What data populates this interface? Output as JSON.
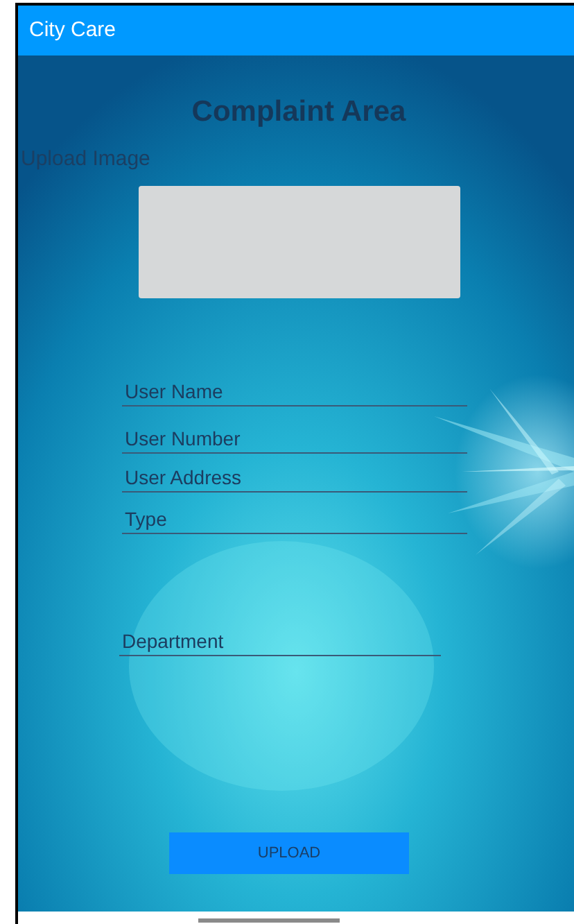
{
  "app_bar": {
    "title": "City Care"
  },
  "screen": {
    "title": "Complaint Area",
    "upload_label": "Upload Image"
  },
  "fields": [
    {
      "placeholder": "User Name"
    },
    {
      "placeholder": "User Number"
    },
    {
      "placeholder": "User Address"
    },
    {
      "placeholder": "Type"
    },
    {
      "placeholder": "Department"
    }
  ],
  "button": {
    "label": "UPLOAD"
  }
}
